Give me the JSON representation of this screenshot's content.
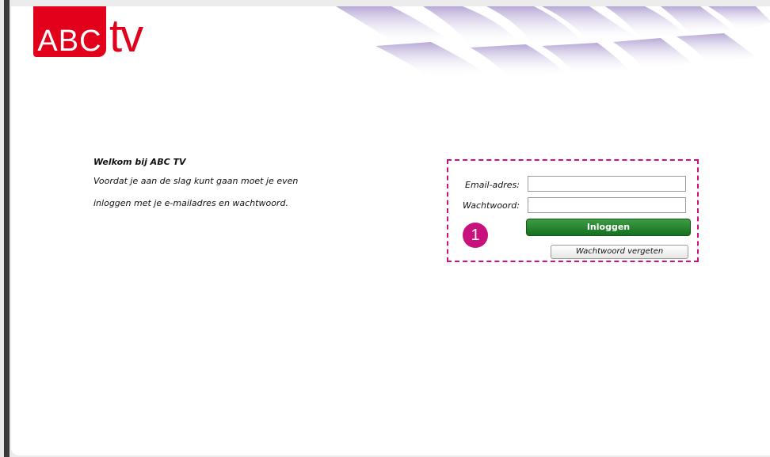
{
  "brand": {
    "logo_text_abc": "ABC",
    "logo_text_tv": "tv",
    "accent_color": "#e3001b"
  },
  "welcome": {
    "title": "Welkom bij ABC TV",
    "line1": "Voordat je aan de slag kunt gaan moet je even",
    "line2": "inloggen met je e-mailadres en wachtwoord."
  },
  "login": {
    "email_label": "Email-adres:",
    "email_value": "",
    "password_label": "Wachtwoord:",
    "password_value": "",
    "login_button_label": "Inloggen",
    "forgot_button_label": "Wachtwoord vergeten",
    "button_color": "#1f7a29"
  },
  "annotation": {
    "step_number": "1",
    "highlight_color": "#d0107f"
  }
}
